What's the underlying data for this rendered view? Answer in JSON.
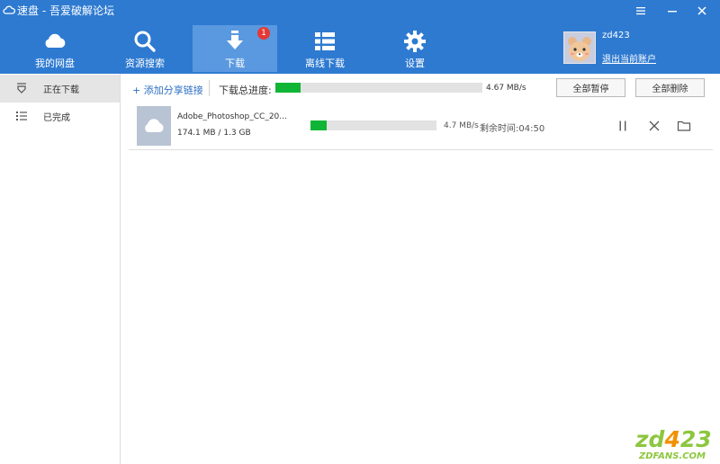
{
  "window": {
    "title": "速盘 - 吾爱破解论坛",
    "icons": [
      "cloud-icon",
      "menu-icon",
      "minimize-icon",
      "close-icon"
    ]
  },
  "nav": {
    "items": [
      {
        "label": "我的网盘",
        "icon": "cloud-icon"
      },
      {
        "label": "资源搜索",
        "icon": "search-icon"
      },
      {
        "label": "下载",
        "icon": "download-arrow-icon",
        "badge": "1",
        "active": true
      },
      {
        "label": "离线下载",
        "icon": "grid-icon"
      },
      {
        "label": "设置",
        "icon": "gear-icon"
      }
    ]
  },
  "user": {
    "name": "zd423",
    "logout": "退出当前账户"
  },
  "sidebar": {
    "items": [
      {
        "label": "正在下载",
        "icon": "download-tray-icon",
        "active": true
      },
      {
        "label": "已完成",
        "icon": "list-icon",
        "active": false
      }
    ]
  },
  "toolbar": {
    "add_link": "+ 添加分享链接",
    "total_label": "下载总进度:",
    "total_progress": 0.12,
    "total_speed": "4.67 MB/s",
    "pause_all": "全部暂停",
    "delete_all": "全部删除"
  },
  "tasks": [
    {
      "name": "Adobe_Photoshop_CC_20...",
      "size": "174.1 MB / 1.3 GB",
      "progress": 0.13,
      "speed": "4.7 MB/s",
      "remaining": "剩余时间:04:50",
      "actions": [
        "pause-icon",
        "cancel-icon",
        "folder-icon"
      ]
    }
  ],
  "watermark": {
    "logo": "zd423",
    "site": "ZDFANS.COM"
  },
  "colors": {
    "brand": "#2e7ad1",
    "active_nav": "#5a99e0",
    "progress": "#11b535",
    "badge": "#e53935"
  }
}
